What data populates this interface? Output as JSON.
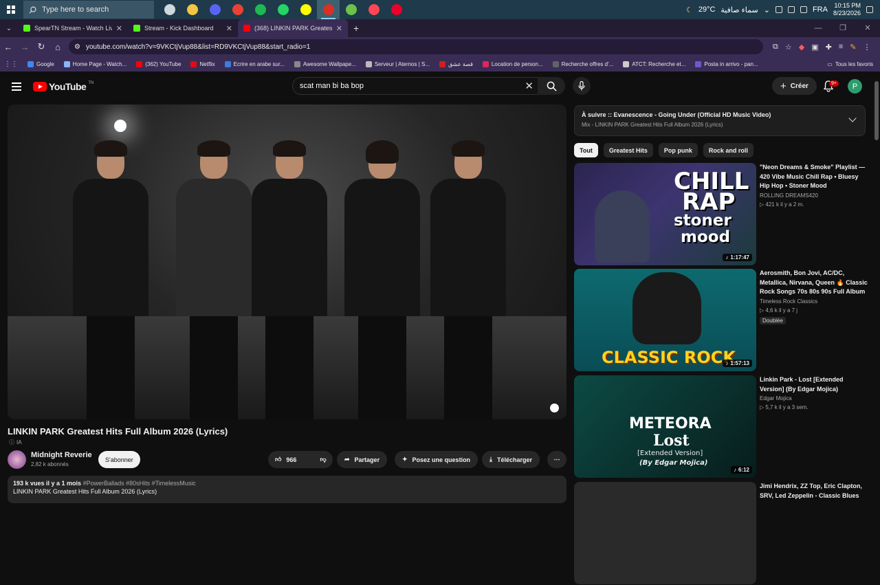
{
  "taskbar": {
    "search_placeholder": "Type here to search",
    "weather_temp": "29°C",
    "weather_text": "سماء صافية",
    "lang": "FRA",
    "time": "10:15 PM",
    "date": "8/23/2026",
    "apps": [
      {
        "name": "task-view-icon",
        "color": "#cfd8dc"
      },
      {
        "name": "file-explorer-icon",
        "color": "#f4c542"
      },
      {
        "name": "discord-icon",
        "color": "#5865f2"
      },
      {
        "name": "chrome-icon",
        "color": "#e94235"
      },
      {
        "name": "spotify-icon",
        "color": "#1db954"
      },
      {
        "name": "whatsapp-icon",
        "color": "#25d366"
      },
      {
        "name": "snapchat-icon",
        "color": "#fffc00"
      },
      {
        "name": "chrome-profile-icon",
        "color": "#d93025"
      },
      {
        "name": "xbox-icon",
        "color": "#6cc24a"
      },
      {
        "name": "valorant-icon",
        "color": "#ff4655"
      },
      {
        "name": "riot-icon",
        "color": "#eb0029"
      }
    ]
  },
  "browser": {
    "tabs": [
      {
        "title": "SpearTN Stream - Watch Live o",
        "color": "#53fc18",
        "active": false
      },
      {
        "title": "Stream - Kick Dashboard",
        "color": "#53fc18",
        "active": false
      },
      {
        "title": "(368) LINKIN PARK Greatest",
        "color": "#ff0000",
        "active": true
      }
    ],
    "url": "youtube.com/watch?v=9VKCtjVup88&list=RD9VKCtjVup88&start_radio=1",
    "bookmarks": [
      {
        "label": "Google",
        "color": "#4285f4"
      },
      {
        "label": "Home Page - Watch...",
        "color": "#8ab4f8"
      },
      {
        "label": "(362) YouTube",
        "color": "#ff0000"
      },
      {
        "label": "Netflix",
        "color": "#e50914"
      },
      {
        "label": "Ecrire en arabe sur...",
        "color": "#3b7de0"
      },
      {
        "label": "Awesome Wallpape...",
        "color": "#888888"
      },
      {
        "label": "Serveur | Aternos | S...",
        "color": "#bbbbbb"
      },
      {
        "label": "قصة عشق",
        "color": "#d01f1f"
      },
      {
        "label": "Location de person...",
        "color": "#e0245e"
      },
      {
        "label": "Recherche offres d'...",
        "color": "#5f6368"
      },
      {
        "label": "ATCT: Recherche et...",
        "color": "#cccccc"
      },
      {
        "label": "Posta in arrivo - pan...",
        "color": "#6a5acd"
      }
    ],
    "all_bookmarks": "Tous les favoris"
  },
  "youtube": {
    "logo": "YouTube",
    "logo_tm": "TN",
    "search_value": "scat man bi ba bop",
    "create_label": "Créer",
    "notif_count": "9+",
    "avatar_letter": "P",
    "video": {
      "title": "LINKIN PARK Greatest Hits Full Album 2026 (Lyrics)",
      "ai_label": "IA",
      "channel": "Midnight Reverie",
      "subscribers": "2,82 k abonnés",
      "subscribe": "S'abonner",
      "likes": "966",
      "share": "Partager",
      "ask": "Posez une question",
      "download": "Télécharger",
      "views": "193 k vues  il y a 1 mois",
      "hashtags": "#PowerBallads #80sHits #TimelessMusic",
      "desc_line": "LINKIN PARK Greatest Hits Full Album 2026 (Lyrics)"
    },
    "up_next": {
      "label": "À suivre :: Evanescence - Going Under (Official HD Music Video)",
      "sub": "Mix - LINKIN PARK Greatest Hits Full Album 2026 (Lyrics)"
    },
    "chips": [
      "Tout",
      "Greatest Hits",
      "Pop punk",
      "Rock and roll"
    ],
    "recommendations": [
      {
        "title": "\"Neon Dreams & Smoke\" Playlist — 420 Vibe Music  Chill Rap • Bluesy Hip Hop • Stoner Mood",
        "channel": "ROLLING DREAMS420",
        "meta": "▷ 421 k   il y a 2 m.",
        "duration": "1:17:47",
        "thumb_text": [
          "CHILL",
          "RAP",
          "stoner",
          "mood"
        ]
      },
      {
        "title": "Aerosmith, Bon Jovi, AC/DC, Metallica, Nirvana, Queen 🔥 Classic Rock Songs 70s 80s 90s Full Album",
        "channel": "Timeless Rock Classics",
        "meta": "▷ 4,6 k   il y a 7 j",
        "badge": "Doublée",
        "duration": "1:57:13",
        "thumb_text": [
          "CLASSIC ROCK"
        ]
      },
      {
        "title": "Linkin Park - Lost [Extended Version] (By Edgar Mojica)",
        "channel": "Edgar Mojica",
        "meta": "▷ 5,7 k   il y a 3 sem.",
        "duration": "6:12",
        "thumb_text": [
          "METEORA",
          "Lost",
          "[Extended Version]",
          "(By Edgar Mojica)"
        ]
      },
      {
        "title": "Jimi Hendrix, ZZ Top, Eric Clapton, SRV, Led Zeppelin - Classic Blues",
        "channel": "",
        "meta": "",
        "duration": ""
      }
    ]
  }
}
